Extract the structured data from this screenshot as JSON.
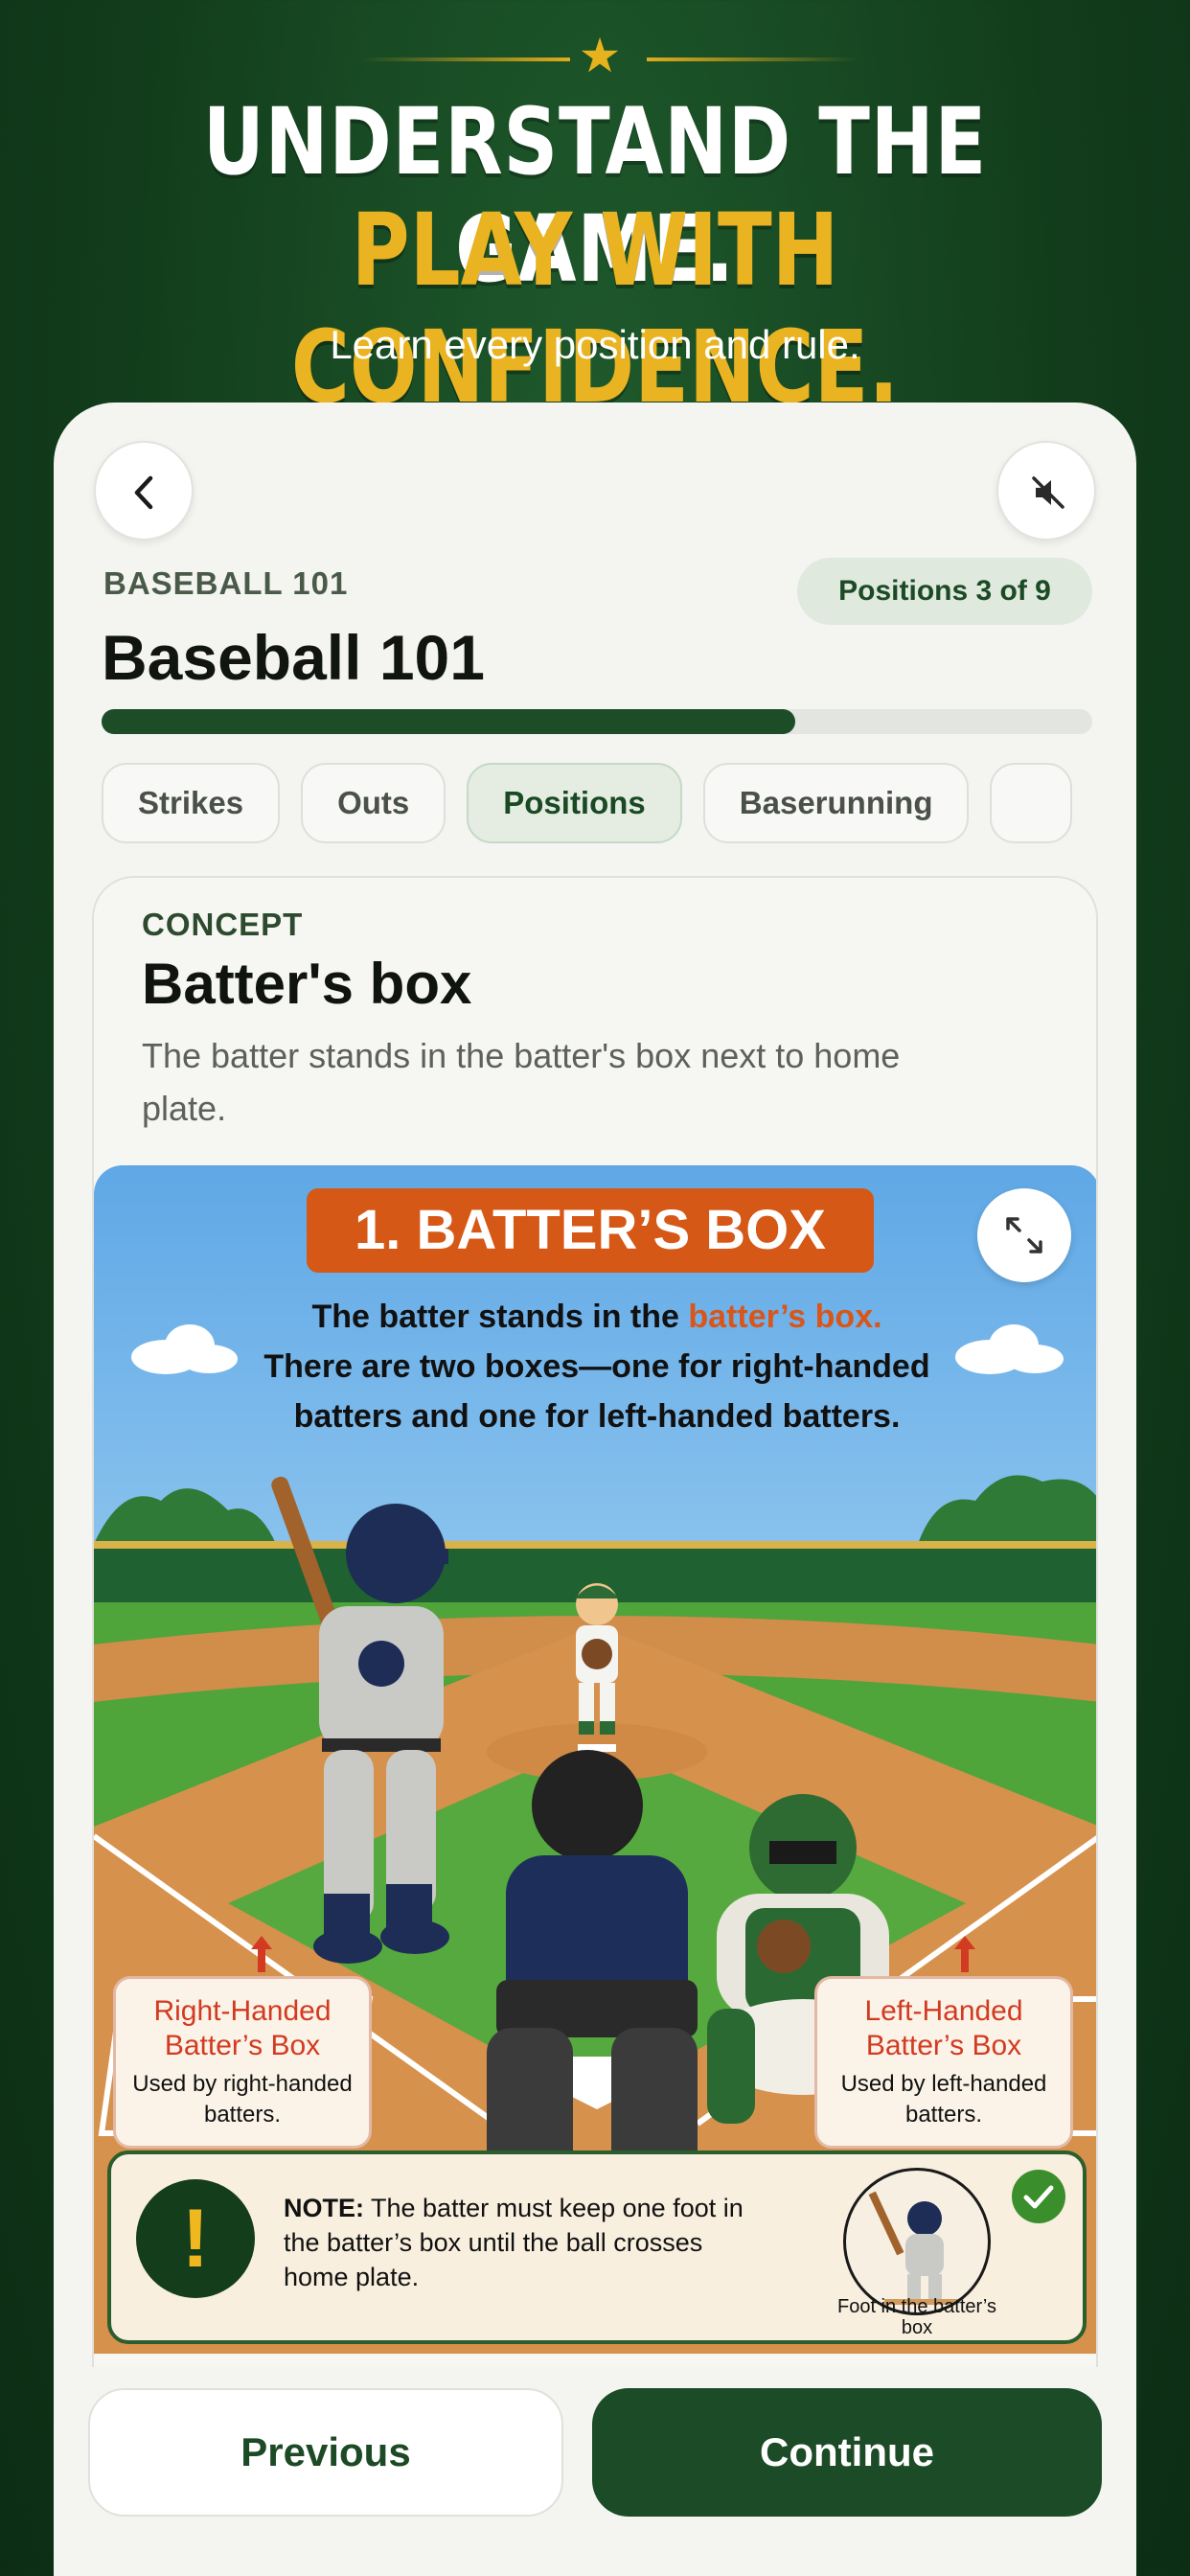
{
  "hero": {
    "line1": "UNDERSTAND THE GAME.",
    "line2": "PLAY WITH CONFIDENCE.",
    "subtitle": "Learn every position and rule."
  },
  "header": {
    "course_label": "BASEBALL 101",
    "position_badge": "Positions 3 of 9",
    "title": "Baseball 101",
    "progress_percent": 70
  },
  "tabs": [
    {
      "label": "Strikes",
      "active": false
    },
    {
      "label": "Outs",
      "active": false
    },
    {
      "label": "Positions",
      "active": true
    },
    {
      "label": "Baserunning",
      "active": false
    }
  ],
  "concept": {
    "label": "CONCEPT",
    "title": "Batter's box",
    "description": "The batter stands in the batter's box next to home plate."
  },
  "illustration": {
    "banner": "1. BATTER’S BOX",
    "explain_prefix": "The batter stands in the ",
    "explain_highlight": "batter’s box.",
    "explain_rest": "There are two boxes—one for right-handed batters and one for left-handed batters.",
    "left_box_title": "Right-Handed Batter’s Box",
    "left_box_sub": "Used by right-handed batters.",
    "right_box_title": "Left-Handed Batter’s Box",
    "right_box_sub": "Used by left-handed batters.",
    "note_label": "NOTE:",
    "note_text": " The batter must keep one foot in the batter’s box until the ball crosses home plate.",
    "note_caption": "Foot in the batter’s box"
  },
  "footer": {
    "previous": "Previous",
    "continue": "Continue"
  },
  "colors": {
    "brand_green": "#1c4b27",
    "accent_gold": "#e9b321",
    "banner_orange": "#d55816",
    "highlight_red": "#d23a21"
  },
  "icons": {
    "back": "chevron-left-icon",
    "mute": "speaker-muted-icon",
    "expand": "expand-arrows-icon",
    "note": "exclamation-icon",
    "check": "checkmark-icon",
    "hero": "star-icon"
  }
}
